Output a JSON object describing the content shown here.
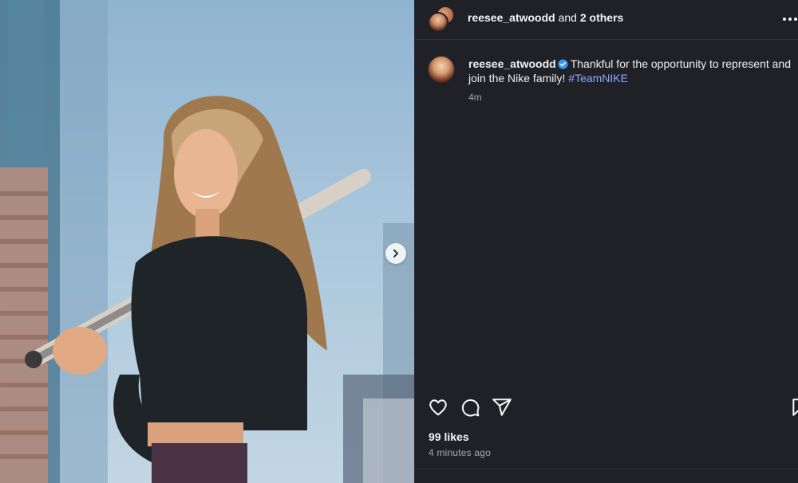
{
  "post": {
    "header": {
      "username": "reesee_atwoodd",
      "joiner": " and ",
      "others": "2 others"
    },
    "caption": {
      "username": "reesee_atwoodd",
      "text": "Thankful for the opportunity to represent and join the Nike family! ",
      "hashtag": "#TeamNIKE",
      "time": "4m"
    },
    "likes": "99 likes",
    "posted_ago": "4 minutes ago",
    "icons": {
      "like": "heart-icon",
      "comment": "comment-icon",
      "share": "send-icon",
      "save": "bookmark-icon",
      "next": "chevron-right-icon",
      "more": "more-horizontal-icon",
      "verified": "verified-badge-icon"
    },
    "colors": {
      "panel_bg": "#202027",
      "hashtag": "#8fa9ff",
      "verified": "#3897f0",
      "muted_text": "#a8a8a8"
    }
  }
}
